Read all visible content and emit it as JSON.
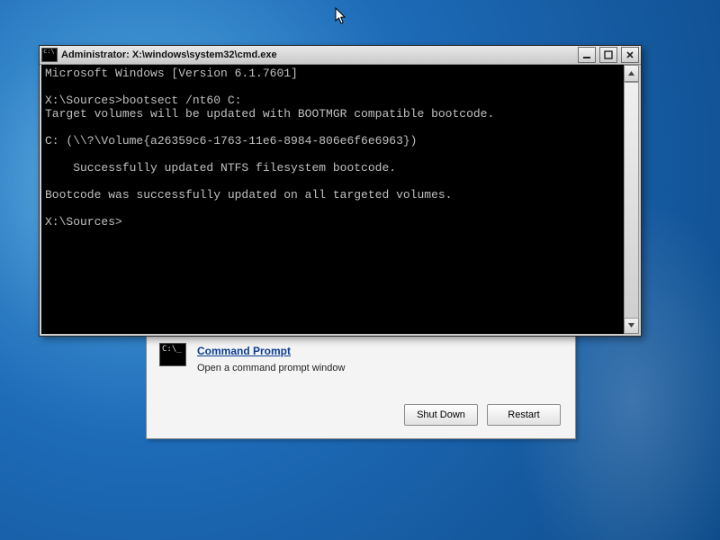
{
  "cmd": {
    "title": "Administrator: X:\\windows\\system32\\cmd.exe",
    "lines": [
      "Microsoft Windows [Version 6.1.7601]",
      "",
      "X:\\Sources>bootsect /nt60 C:",
      "Target volumes will be updated with BOOTMGR compatible bootcode.",
      "",
      "C: (\\\\?\\Volume{a26359c6-1763-11e6-8984-806e6f6e6963})",
      "",
      "    Successfully updated NTFS filesystem bootcode.",
      "",
      "Bootcode was successfully updated on all targeted volumes.",
      "",
      "X:\\Sources>"
    ]
  },
  "dialog": {
    "tool_link": "Command Prompt",
    "tool_sub": "Open a command prompt window",
    "shutdown": "Shut Down",
    "restart": "Restart"
  }
}
